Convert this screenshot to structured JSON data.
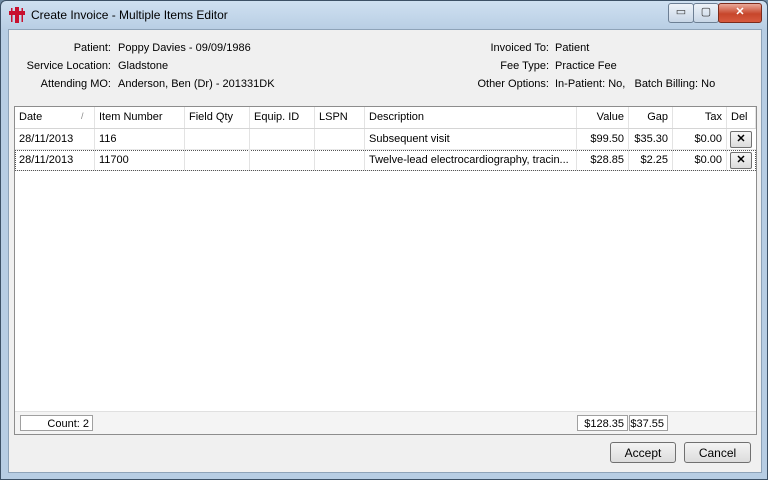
{
  "window": {
    "title": "Create Invoice - Multiple Items Editor",
    "controls": {
      "minimize": "▭",
      "maximize": "▢",
      "close": "✕"
    }
  },
  "info": {
    "patient_label": "Patient:",
    "patient_value": "Poppy Davies - 09/09/1986",
    "service_location_label": "Service Location:",
    "service_location_value": "Gladstone",
    "attending_mo_label": "Attending MO:",
    "attending_mo_value": "Anderson, Ben (Dr) - 201331DK",
    "invoiced_to_label": "Invoiced To:",
    "invoiced_to_value": "Patient",
    "fee_type_label": "Fee Type:",
    "fee_type_value": "Practice Fee",
    "other_options_label": "Other Options:",
    "other_options_value": "In-Patient: No,   Batch Billing: No"
  },
  "grid": {
    "columns": [
      "Date",
      "Item Number",
      "Field Qty",
      "Equip. ID",
      "LSPN",
      "Description",
      "Value",
      "Gap",
      "Tax",
      "Del"
    ],
    "sort_indicator": "/",
    "rows": [
      {
        "date": "28/11/2013",
        "item_number": "116",
        "field_qty": "",
        "equip_id": "",
        "lspn": "",
        "description": "Subsequent visit",
        "value": "$99.50",
        "gap": "$35.30",
        "tax": "$0.00",
        "del": "✕"
      },
      {
        "date": "28/11/2013",
        "item_number": "11700",
        "field_qty": "",
        "equip_id": "",
        "lspn": "",
        "description": "Twelve-lead electrocardiography, tracin...",
        "value": "$28.85",
        "gap": "$2.25",
        "tax": "$0.00",
        "del": "✕"
      }
    ],
    "footer": {
      "count": "Count: 2",
      "total_value": "$128.35",
      "total_gap": "$37.55"
    }
  },
  "buttons": {
    "accept": "Accept",
    "cancel": "Cancel"
  },
  "colors": {
    "app_icon": "#c8102e"
  }
}
